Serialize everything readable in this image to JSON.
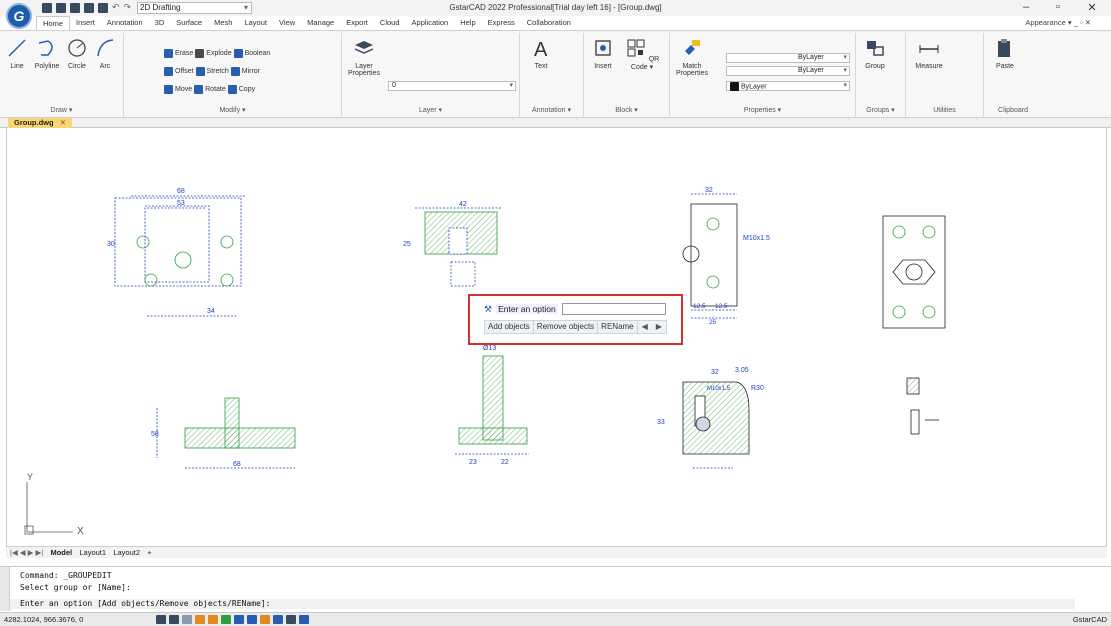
{
  "titlebar": {
    "title": "GstarCAD 2022 Professional[Trial day left 16] - [Group.dwg]",
    "workspace": "2D Drafting",
    "workspace_arrow": "▾",
    "logo": "G",
    "min": "–",
    "restore": "▫",
    "close": "✕"
  },
  "tabs": [
    "Home",
    "Insert",
    "Annotation",
    "3D",
    "Surface",
    "Mesh",
    "Layout",
    "View",
    "Manage",
    "Export",
    "Cloud",
    "Application",
    "Help",
    "Express",
    "Collaboration"
  ],
  "appearance": "Appearance ▾  _  ▫  ✕",
  "ribbon": {
    "draw": {
      "label": "Draw ▾",
      "tools": [
        "Line",
        "Polyline",
        "Circle",
        "Arc"
      ]
    },
    "modify": {
      "label": "Modify ▾",
      "rows": [
        [
          "Erase",
          "Explode",
          "Boolean"
        ],
        [
          "Offset",
          "Stretch",
          "Mirror"
        ],
        [
          "Move",
          "Rotate",
          "Copy"
        ]
      ]
    },
    "layer": {
      "label": "Layer ▾",
      "tool": "Layer Properties",
      "current": "0"
    },
    "annotation": {
      "label": "Annotation ▾",
      "tool": "Text"
    },
    "block": {
      "label": "Block ▾",
      "insert": "Insert",
      "qr": "QR Code ▾"
    },
    "properties": {
      "label": "Properties ▾",
      "match": "Match Properties",
      "bylayer1": "ByLayer",
      "bylayer2": "ByLayer",
      "bylayer3": "ByLayer"
    },
    "groups": {
      "label": "Groups ▾",
      "tool": "Group"
    },
    "utilities": {
      "label": "Utilities",
      "tool": "Measure"
    },
    "clipboard": {
      "label": "Clipboard",
      "tool": "Paste"
    }
  },
  "document_tab": {
    "name": "Group.dwg",
    "close": "✕"
  },
  "command_popup": {
    "prompt": "Enter an option",
    "options": [
      "Add objects",
      "Remove objects",
      "REName"
    ],
    "prev": "◀",
    "next": "▶"
  },
  "drawing_labels": {
    "d1_w": "68",
    "d1_w2": "53",
    "d1_h": "30",
    "d1_b": "34",
    "d2_top": "42",
    "d2_h": "25",
    "d3_w": "32",
    "d3_thread": "M10x1.5",
    "d3_b1": "12.5",
    "d3_b2": "12.5",
    "d3_b3": "25",
    "d5_b": "68",
    "d5_h": "58",
    "d6_top": "Ø13",
    "d6_b1": "23",
    "d6_b2": "22",
    "d7_w": "32",
    "d7_w2": "3.05",
    "d7_thread": "M10x1.5",
    "d7_r": "R30",
    "d7_h": "33"
  },
  "ucs": {
    "x": "X",
    "y": "Y"
  },
  "layout_tabs": [
    "Model",
    "Layout1",
    "Layout2",
    "+"
  ],
  "layout_nav": "|◀ ◀ ▶ ▶|",
  "command_lines": [
    "Command: _GROUPEDIT",
    "Select group or [Name]:",
    "Enter an option [Add objects/Remove objects/REName]:"
  ],
  "statusbar": {
    "coords": "4282.1024, 966.3676, 0",
    "app": "GstarCAD"
  },
  "colors": {
    "accent": "#1d5da8",
    "popup_border": "#d32f2f",
    "doc_tab": "#f7d771",
    "draw_blue": "#1f3fbf",
    "draw_green": "#2e9e3e"
  }
}
